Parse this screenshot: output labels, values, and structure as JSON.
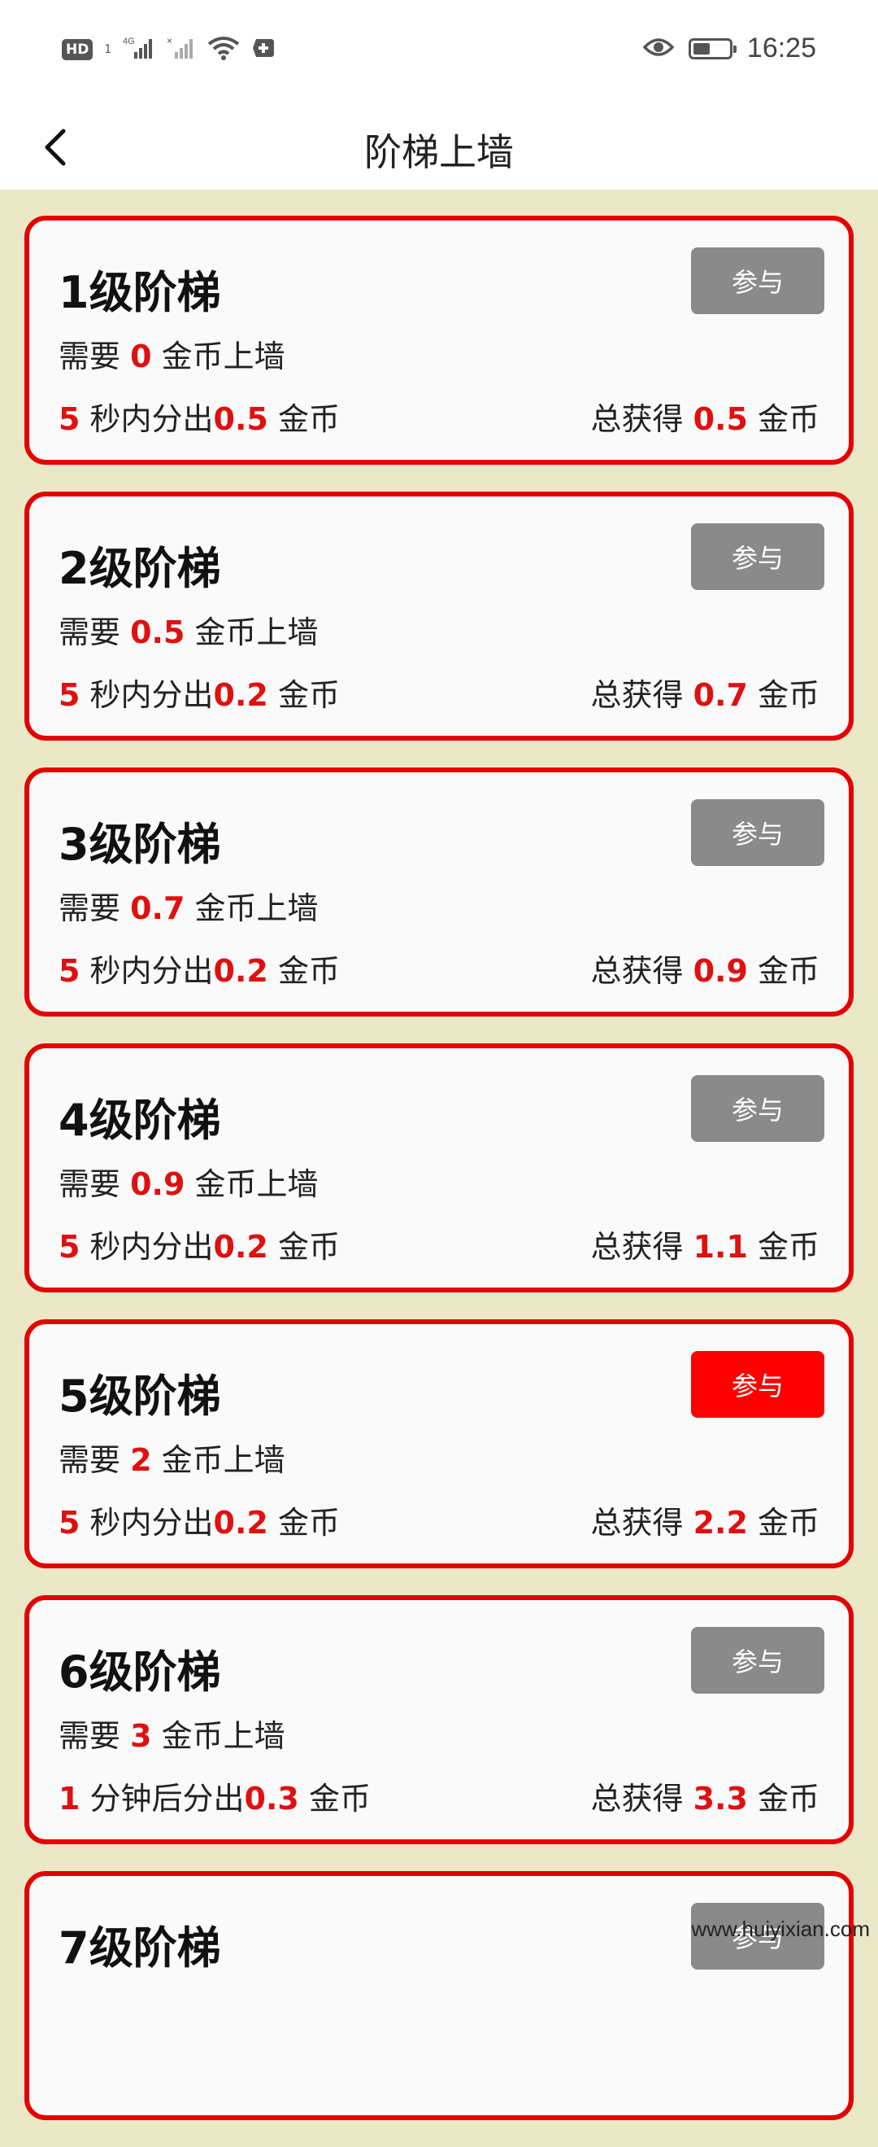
{
  "status_bar": {
    "hd_label": "HD",
    "sim1": "1",
    "signal_label": "4G",
    "time": "16:25"
  },
  "nav": {
    "title": "阶梯上墙"
  },
  "cards": [
    {
      "title": "1级阶梯",
      "button": "参与",
      "active": false,
      "need_prefix": "需要 ",
      "need_value": "0",
      "need_suffix": " 金币上墙",
      "time_value": "5",
      "time_text": " 秒内分出",
      "give_value": "0.5",
      "give_suffix": " 金币",
      "total_prefix": "总获得 ",
      "total_value": "0.5",
      "total_suffix": " 金币"
    },
    {
      "title": "2级阶梯",
      "button": "参与",
      "active": false,
      "need_prefix": "需要 ",
      "need_value": "0.5",
      "need_suffix": " 金币上墙",
      "time_value": "5",
      "time_text": " 秒内分出",
      "give_value": "0.2",
      "give_suffix": " 金币",
      "total_prefix": "总获得 ",
      "total_value": "0.7",
      "total_suffix": " 金币"
    },
    {
      "title": "3级阶梯",
      "button": "参与",
      "active": false,
      "need_prefix": "需要 ",
      "need_value": "0.7",
      "need_suffix": " 金币上墙",
      "time_value": "5",
      "time_text": " 秒内分出",
      "give_value": "0.2",
      "give_suffix": " 金币",
      "total_prefix": "总获得 ",
      "total_value": "0.9",
      "total_suffix": " 金币"
    },
    {
      "title": "4级阶梯",
      "button": "参与",
      "active": false,
      "need_prefix": "需要 ",
      "need_value": "0.9",
      "need_suffix": " 金币上墙",
      "time_value": "5",
      "time_text": " 秒内分出",
      "give_value": "0.2",
      "give_suffix": " 金币",
      "total_prefix": "总获得 ",
      "total_value": "1.1",
      "total_suffix": " 金币"
    },
    {
      "title": "5级阶梯",
      "button": "参与",
      "active": true,
      "need_prefix": "需要 ",
      "need_value": "2",
      "need_suffix": " 金币上墙",
      "time_value": "5",
      "time_text": " 秒内分出",
      "give_value": "0.2",
      "give_suffix": " 金币",
      "total_prefix": "总获得 ",
      "total_value": "2.2",
      "total_suffix": " 金币"
    },
    {
      "title": "6级阶梯",
      "button": "参与",
      "active": false,
      "need_prefix": "需要 ",
      "need_value": "3",
      "need_suffix": " 金币上墙",
      "time_value": "1",
      "time_text": " 分钟后分出",
      "give_value": "0.3",
      "give_suffix": " 金币",
      "total_prefix": "总获得 ",
      "total_value": "3.3",
      "total_suffix": " 金币"
    },
    {
      "title": "7级阶梯",
      "button": "参与",
      "active": false,
      "need_prefix": "",
      "need_value": "",
      "need_suffix": "",
      "time_value": "",
      "time_text": "",
      "give_value": "",
      "give_suffix": "",
      "total_prefix": "",
      "total_value": "",
      "total_suffix": ""
    }
  ],
  "colors": {
    "accent_red": "#e50000",
    "button_active": "#ff0000",
    "button_inactive": "#8a8a8a",
    "page_background": "#ebe8c8"
  },
  "watermark": "www.huiyixian.com"
}
